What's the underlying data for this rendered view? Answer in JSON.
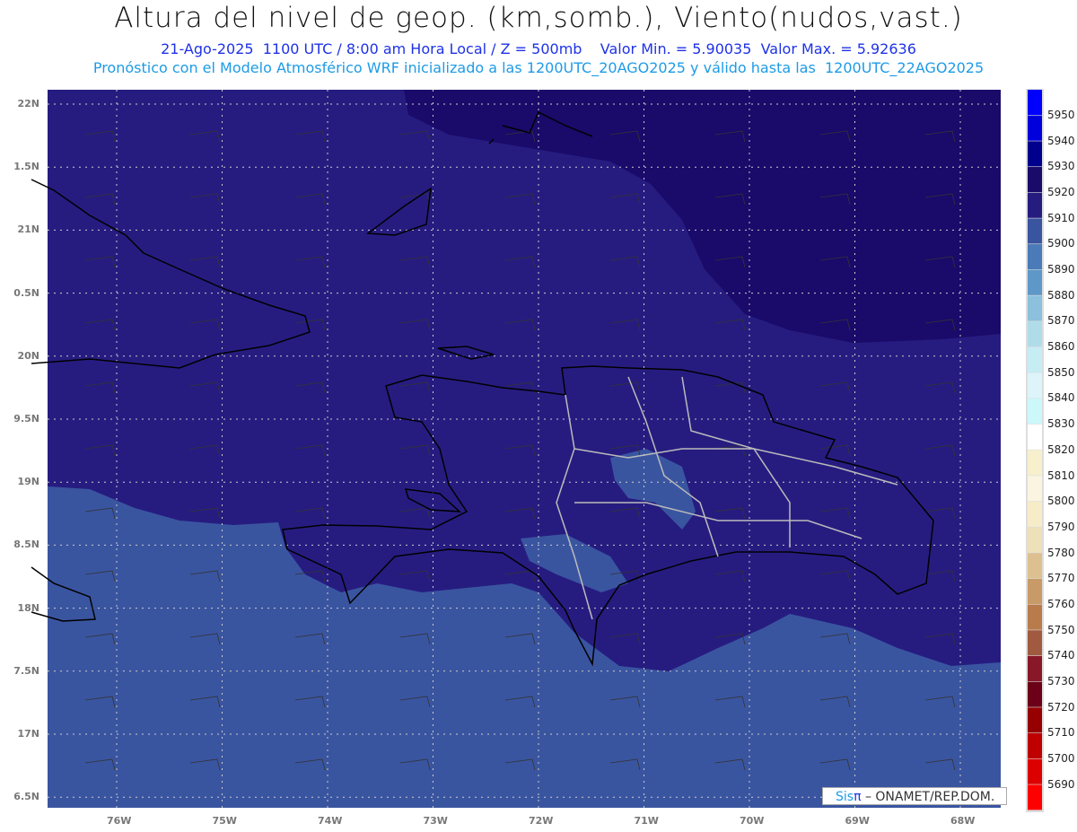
{
  "title": "Altura del nivel de geop. (km,somb.), Viento(nudos,vast.)",
  "subtitle1": "21-Ago-2025  1100 UTC / 8:00 am Hora Local / Z = 500mb    Valor Min. = 5.90035  Valor Max. = 5.92636",
  "subtitle2": "Pronóstico con el Modelo Atmosférico WRF inicializado a las 1200UTC_20AGO2025 y válido hasta las  1200UTC_22AGO2025",
  "lat_labels": [
    "22N",
    "1.5N",
    "21N",
    "0.5N",
    "20N",
    "9.5N",
    "19N",
    "8.5N",
    "18N",
    "7.5N",
    "17N",
    "6.5N"
  ],
  "lon_labels": [
    "76W",
    "75W",
    "74W",
    "73W",
    "72W",
    "71W",
    "70W",
    "69W",
    "68W"
  ],
  "colorbar": {
    "labels": [
      "5950",
      "5940",
      "5930",
      "5920",
      "5910",
      "5900",
      "5890",
      "5880",
      "5870",
      "5860",
      "5850",
      "5840",
      "5830",
      "5820",
      "5810",
      "5800",
      "5790",
      "5780",
      "5770",
      "5760",
      "5750",
      "5740",
      "5730",
      "5720",
      "5710",
      "5700",
      "5690"
    ],
    "colors": [
      "#0000ff",
      "#0000dc",
      "#00008c",
      "#1a0a6a",
      "#261c80",
      "#3a55a0",
      "#4a7ab8",
      "#5e98c8",
      "#8cc0dc",
      "#b0dcea",
      "#c6ecf4",
      "#dcf4fa",
      "#ccf8fa",
      "#ffffff",
      "#f8f0cc",
      "#faf4e0",
      "#f6ecc8",
      "#eee0b8",
      "#dcc090",
      "#c89a68",
      "#b87c4c",
      "#a05a40",
      "#881828",
      "#6c0018",
      "#960000",
      "#be0000",
      "#dc0000",
      "#ff0000"
    ]
  },
  "map_colors": {
    "high": "#1a0a6a",
    "mid": "#261c80",
    "low": "#3a55a0"
  },
  "logo": {
    "sis": "Sis",
    "pi": "π",
    "rest": " – ONAMET/REP.DOM."
  }
}
